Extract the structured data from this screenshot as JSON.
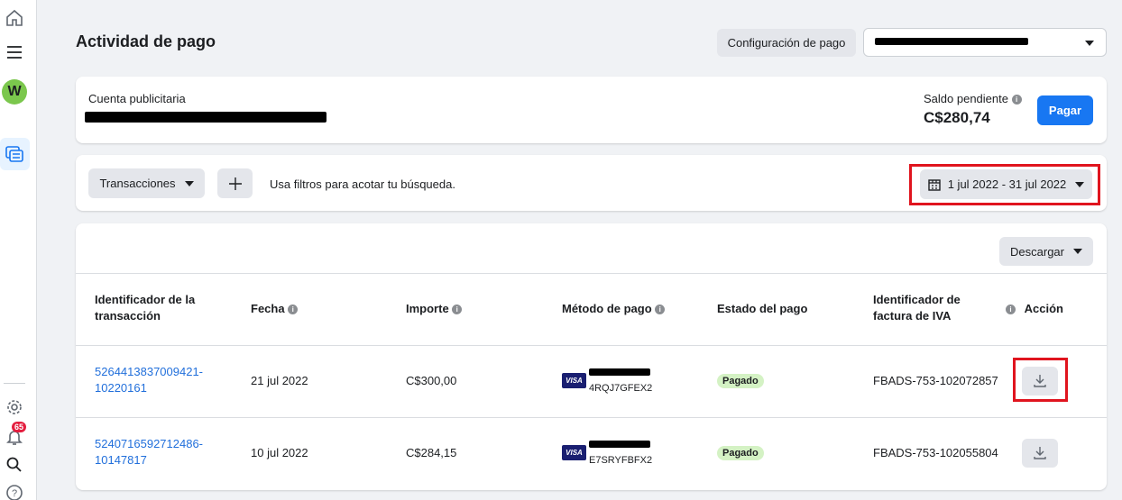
{
  "page": {
    "title": "Actividad de pago",
    "config_button": "Configuración de pago"
  },
  "account_card": {
    "label": "Cuenta publicitaria",
    "balance_label": "Saldo pendiente",
    "balance_value": "C$280,74",
    "pay_button": "Pagar"
  },
  "filter_bar": {
    "transactions_button": "Transacciones",
    "add_filter": "+",
    "hint": "Usa filtros para acotar tu búsqueda.",
    "date_range": "1 jul 2022 - 31 jul 2022"
  },
  "table": {
    "download_button": "Descargar",
    "columns": [
      "Identificador de la transacción",
      "Fecha",
      "Importe",
      "Método de pago",
      "Estado del pago",
      "Identificador de factura de IVA",
      "Acción"
    ],
    "rows": [
      {
        "id_line1": "5264413837009421-",
        "id_line2": "10220161",
        "date": "21 jul 2022",
        "amount": "C$300,00",
        "card_brand": "VISA",
        "card_code": "4RQJ7GFEX2",
        "status": "Pagado",
        "invoice": "FBADS-753-102072857"
      },
      {
        "id_line1": "5240716592712486-",
        "id_line2": "10147817",
        "date": "10 jul 2022",
        "amount": "C$284,15",
        "card_brand": "VISA",
        "card_code": "E7SRYFBFX2",
        "status": "Pagado",
        "invoice": "FBADS-753-102055804"
      }
    ]
  },
  "rail": {
    "avatar_letter": "W",
    "notification_count": "65"
  },
  "colors": {
    "primary": "#1877f2",
    "highlight": "#e0141e",
    "paid_badge": "#d4f2c4",
    "link": "#216fdb"
  }
}
